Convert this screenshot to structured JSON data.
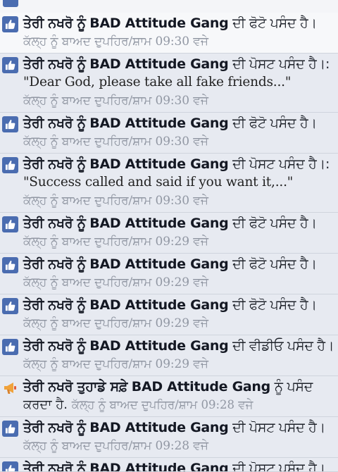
{
  "notifications": [
    {
      "actor": "ਤੇਰੀ ਨਖਰੋ ਨੂੰ",
      "page": "BAD Attitude Gang",
      "action": "ਦੀ ਫੋਟੋ ਪਸੰਦ ਹੈ।",
      "quote": "",
      "time": "ਕੱਲ੍ਹ ਨੂੰ ਬਾਅਦ ਦੁਪਹਿਰ/ਸ਼ਾਮ 09:30 ਵਜੇ",
      "icon": "like-icon",
      "read": true
    },
    {
      "actor": "ਤੇਰੀ ਨਖਰੋ ਨੂੰ",
      "page": "BAD Attitude Gang",
      "action": "ਦੀ ਪੋਸਟ ਪਸੰਦ ਹੈ।:",
      "quote": "\"Dear God, please take all fake friends...\"",
      "time": "ਕੱਲ੍ਹ ਨੂੰ ਬਾਅਦ ਦੁਪਹਿਰ/ਸ਼ਾਮ 09:30 ਵਜੇ",
      "icon": "like-icon",
      "read": false
    },
    {
      "actor": "ਤੇਰੀ ਨਖਰੋ ਨੂੰ",
      "page": "BAD Attitude Gang",
      "action": "ਦੀ ਫੋਟੋ ਪਸੰਦ ਹੈ।",
      "quote": "",
      "time": "ਕੱਲ੍ਹ ਨੂੰ ਬਾਅਦ ਦੁਪਹਿਰ/ਸ਼ਾਮ 09:30 ਵਜੇ",
      "icon": "like-icon",
      "read": false
    },
    {
      "actor": "ਤੇਰੀ ਨਖਰੋ ਨੂੰ",
      "page": "BAD Attitude Gang",
      "action": "ਦੀ ਪੋਸਟ ਪਸੰਦ ਹੈ।:",
      "quote": "\"Success called and said if you want it,...\"",
      "time": "ਕੱਲ੍ਹ ਨੂੰ ਬਾਅਦ ਦੁਪਹਿਰ/ਸ਼ਾਮ 09:30 ਵਜੇ",
      "icon": "like-icon",
      "read": false
    },
    {
      "actor": "ਤੇਰੀ ਨਖਰੋ ਨੂੰ",
      "page": "BAD Attitude Gang",
      "action": "ਦੀ ਫੋਟੋ ਪਸੰਦ ਹੈ।",
      "quote": "",
      "time": "ਕੱਲ੍ਹ ਨੂੰ ਬਾਅਦ ਦੁਪਹਿਰ/ਸ਼ਾਮ 09:29 ਵਜੇ",
      "icon": "like-icon",
      "read": false
    },
    {
      "actor": "ਤੇਰੀ ਨਖਰੋ ਨੂੰ",
      "page": "BAD Attitude Gang",
      "action": "ਦੀ ਫੋਟੋ ਪਸੰਦ ਹੈ।",
      "quote": "",
      "time": "ਕੱਲ੍ਹ ਨੂੰ ਬਾਅਦ ਦੁਪਹਿਰ/ਸ਼ਾਮ 09:29 ਵਜੇ",
      "icon": "like-icon",
      "read": false
    },
    {
      "actor": "ਤੇਰੀ ਨਖਰੋ ਨੂੰ",
      "page": "BAD Attitude Gang",
      "action": "ਦੀ ਫੋਟੋ ਪਸੰਦ ਹੈ।",
      "quote": "",
      "time": "ਕੱਲ੍ਹ ਨੂੰ ਬਾਅਦ ਦੁਪਹਿਰ/ਸ਼ਾਮ 09:29 ਵਜੇ",
      "icon": "like-icon",
      "read": false
    },
    {
      "actor": "ਤੇਰੀ ਨਖਰੋ ਨੂੰ",
      "page": "BAD Attitude Gang",
      "action": "ਦੀ ਵੀਡੀਓ ਪਸੰਦ ਹੈ।",
      "quote": "",
      "time": "ਕੱਲ੍ਹ ਨੂੰ ਬਾਅਦ ਦੁਪਹਿਰ/ਸ਼ਾਮ 09:29 ਵਜੇ",
      "icon": "like-icon",
      "read": false
    },
    {
      "actor": "ਤੇਰੀ ਨਖਰੋ ਤੁਹਾਡੇ ਸਫ਼ੇ",
      "page": "BAD Attitude Gang",
      "action": "ਨੂੰ ਪਸੰਦ",
      "action2": "ਕਰਦਾ ਹੈ.",
      "quote": "",
      "time": "ਕੱਲ੍ਹ ਨੂੰ ਬਾਅਦ ਦੁਪਹਿਰ/ਸ਼ਾਮ 09:28 ਵਜੇ",
      "icon": "megaphone-icon",
      "read": false
    },
    {
      "actor": "ਤੇਰੀ ਨਖਰੋ ਨੂੰ",
      "page": "BAD Attitude Gang",
      "action": "ਦੀ ਪੋਸਟ ਪਸੰਦ ਹੈ।",
      "quote": "",
      "time": "ਕੱਲ੍ਹ ਨੂੰ ਬਾਅਦ ਦੁਪਹਿਰ/ਸ਼ਾਮ 09:28 ਵਜੇ",
      "icon": "like-icon",
      "read": false
    },
    {
      "actor": "ਤੇਰੀ ਨਖਰੋ ਨੂੰ",
      "page": "BAD Attitude Gang",
      "action": "ਦੀ ਪੋਸਟ ਪਸੰਦ ਹੈ।",
      "quote": "",
      "time": "",
      "icon": "like-icon",
      "read": false
    }
  ],
  "colors": {
    "unread_bg": "#e7eaf1",
    "read_bg": "#f7f8fa",
    "icon_blue": "#4a6cb0",
    "timestamp": "#9197a3",
    "megaphone_orange": "#f0a23b"
  }
}
